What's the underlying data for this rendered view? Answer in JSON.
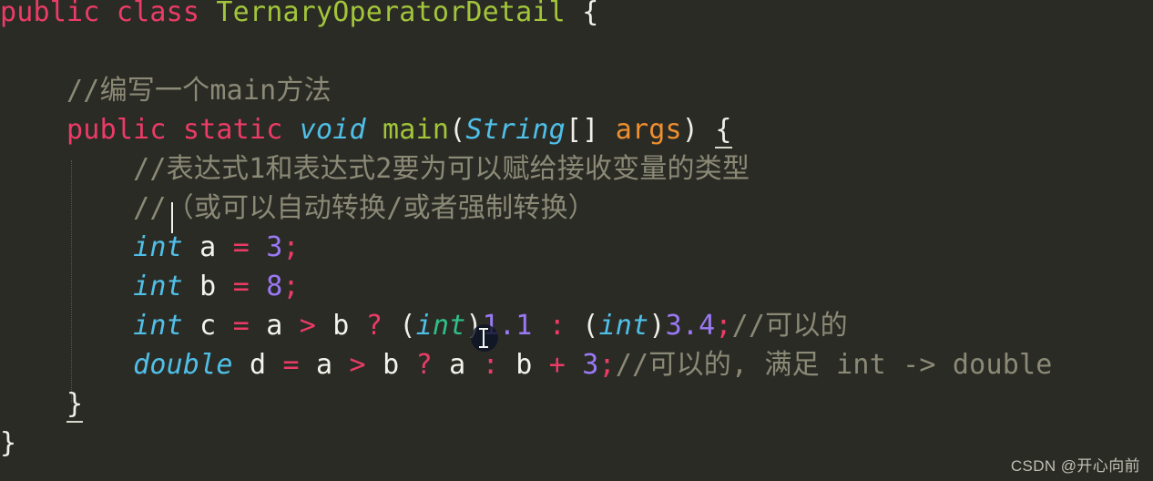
{
  "editor": {
    "theme": "dark",
    "background_color": "#2b2b26",
    "colors": {
      "keyword": "#ec3b67",
      "type": "#4fc0e8",
      "class_name": "#a2c53a",
      "method_name": "#a2c53a",
      "number": "#9a79f5",
      "parameter": "#ef8f2e",
      "comment": "#8b8a76",
      "punctuation": "#f0f0e8",
      "operator": "#ec3b67",
      "variable": "#f4f4ec",
      "hovered_token": "#2fc08a",
      "caret": "#f2f2ea",
      "indent_guide": "#55554c"
    },
    "language": "java",
    "lines": [
      {
        "n": 1,
        "tokens": [
          {
            "t": "public",
            "c": "kw"
          },
          {
            "t": " ",
            "c": "punc"
          },
          {
            "t": "class",
            "c": "kw"
          },
          {
            "t": " ",
            "c": "punc"
          },
          {
            "t": "TernaryOperatorDetail",
            "c": "clsname"
          },
          {
            "t": " ",
            "c": "punc"
          },
          {
            "t": "{",
            "c": "punc"
          }
        ]
      },
      {
        "n": 2,
        "tokens": []
      },
      {
        "n": 3,
        "tokens": [
          {
            "t": "    ",
            "c": "punc"
          },
          {
            "t": "//编写一个main方法",
            "c": "cmt"
          }
        ]
      },
      {
        "n": 4,
        "tokens": [
          {
            "t": "    ",
            "c": "punc"
          },
          {
            "t": "public",
            "c": "kw"
          },
          {
            "t": " ",
            "c": "punc"
          },
          {
            "t": "static",
            "c": "kw"
          },
          {
            "t": " ",
            "c": "punc"
          },
          {
            "t": "void",
            "c": "type"
          },
          {
            "t": " ",
            "c": "punc"
          },
          {
            "t": "main",
            "c": "method"
          },
          {
            "t": "(",
            "c": "punc"
          },
          {
            "t": "String",
            "c": "type"
          },
          {
            "t": "[]",
            "c": "punc"
          },
          {
            "t": " ",
            "c": "punc"
          },
          {
            "t": "args",
            "c": "param"
          },
          {
            "t": ")",
            "c": "punc"
          },
          {
            "t": " ",
            "c": "punc"
          },
          {
            "t": "{",
            "c": "punc brmatch"
          }
        ]
      },
      {
        "n": 5,
        "tokens": [
          {
            "t": "        ",
            "c": "punc"
          },
          {
            "t": "//表达式1和表达式2要为可以赋给接收变量的类型",
            "c": "cmt"
          }
        ]
      },
      {
        "n": 6,
        "tokens": [
          {
            "t": "        ",
            "c": "punc"
          },
          {
            "t": "//",
            "c": "cmt"
          },
          {
            "t": "（或可以自动转换/或者强制转换）",
            "c": "cmt"
          }
        ]
      },
      {
        "n": 7,
        "tokens": [
          {
            "t": "        ",
            "c": "punc"
          },
          {
            "t": "int",
            "c": "type"
          },
          {
            "t": " ",
            "c": "punc"
          },
          {
            "t": "a",
            "c": "var"
          },
          {
            "t": " ",
            "c": "punc"
          },
          {
            "t": "=",
            "c": "op"
          },
          {
            "t": " ",
            "c": "punc"
          },
          {
            "t": "3",
            "c": "num"
          },
          {
            "t": ";",
            "c": "op"
          }
        ]
      },
      {
        "n": 8,
        "tokens": [
          {
            "t": "        ",
            "c": "punc"
          },
          {
            "t": "int",
            "c": "type"
          },
          {
            "t": " ",
            "c": "punc"
          },
          {
            "t": "b",
            "c": "var"
          },
          {
            "t": " ",
            "c": "punc"
          },
          {
            "t": "=",
            "c": "op"
          },
          {
            "t": " ",
            "c": "punc"
          },
          {
            "t": "8",
            "c": "num"
          },
          {
            "t": ";",
            "c": "op"
          }
        ]
      },
      {
        "n": 9,
        "tokens": [
          {
            "t": "        ",
            "c": "punc"
          },
          {
            "t": "int",
            "c": "type"
          },
          {
            "t": " ",
            "c": "punc"
          },
          {
            "t": "c",
            "c": "var"
          },
          {
            "t": " ",
            "c": "punc"
          },
          {
            "t": "=",
            "c": "op"
          },
          {
            "t": " ",
            "c": "punc"
          },
          {
            "t": "a",
            "c": "var"
          },
          {
            "t": " ",
            "c": "punc"
          },
          {
            "t": ">",
            "c": "op"
          },
          {
            "t": " ",
            "c": "punc"
          },
          {
            "t": "b",
            "c": "var"
          },
          {
            "t": " ",
            "c": "punc"
          },
          {
            "t": "?",
            "c": "op"
          },
          {
            "t": " ",
            "c": "punc"
          },
          {
            "t": "(",
            "c": "punc"
          },
          {
            "t": "i",
            "c": "type"
          },
          {
            "t": "nt",
            "c": "type hovertok"
          },
          {
            "t": ")",
            "c": "punc"
          },
          {
            "t": "1.1",
            "c": "num"
          },
          {
            "t": " ",
            "c": "punc"
          },
          {
            "t": ":",
            "c": "op"
          },
          {
            "t": " ",
            "c": "punc"
          },
          {
            "t": "(",
            "c": "punc"
          },
          {
            "t": "int",
            "c": "type"
          },
          {
            "t": ")",
            "c": "punc"
          },
          {
            "t": "3.4",
            "c": "num"
          },
          {
            "t": ";",
            "c": "op"
          },
          {
            "t": "//可以的",
            "c": "cmt"
          }
        ]
      },
      {
        "n": 10,
        "tokens": [
          {
            "t": "        ",
            "c": "punc"
          },
          {
            "t": "double",
            "c": "type"
          },
          {
            "t": " ",
            "c": "punc"
          },
          {
            "t": "d",
            "c": "var"
          },
          {
            "t": " ",
            "c": "punc"
          },
          {
            "t": "=",
            "c": "op"
          },
          {
            "t": " ",
            "c": "punc"
          },
          {
            "t": "a",
            "c": "var"
          },
          {
            "t": " ",
            "c": "punc"
          },
          {
            "t": ">",
            "c": "op"
          },
          {
            "t": " ",
            "c": "punc"
          },
          {
            "t": "b",
            "c": "var"
          },
          {
            "t": " ",
            "c": "punc"
          },
          {
            "t": "?",
            "c": "op"
          },
          {
            "t": " ",
            "c": "punc"
          },
          {
            "t": "a",
            "c": "var"
          },
          {
            "t": " ",
            "c": "punc"
          },
          {
            "t": ":",
            "c": "op"
          },
          {
            "t": " ",
            "c": "punc"
          },
          {
            "t": "b",
            "c": "var"
          },
          {
            "t": " ",
            "c": "punc"
          },
          {
            "t": "+",
            "c": "op"
          },
          {
            "t": " ",
            "c": "punc"
          },
          {
            "t": "3",
            "c": "num"
          },
          {
            "t": ";",
            "c": "op"
          },
          {
            "t": "//可以的, 满足 int -> double",
            "c": "cmt"
          }
        ]
      },
      {
        "n": 11,
        "tokens": [
          {
            "t": "    ",
            "c": "punc"
          },
          {
            "t": "}",
            "c": "punc brmatch"
          }
        ]
      },
      {
        "n": 12,
        "tokens": [
          {
            "t": "}",
            "c": "punc"
          }
        ]
      }
    ],
    "caret": {
      "line": 6,
      "column": 10
    },
    "mouse_cursor": {
      "shape": "i-beam",
      "line": 9,
      "over_token": "int"
    },
    "indent_guides": [
      {
        "level": 1
      }
    ]
  },
  "watermark": {
    "text": "CSDN @开心向前"
  }
}
